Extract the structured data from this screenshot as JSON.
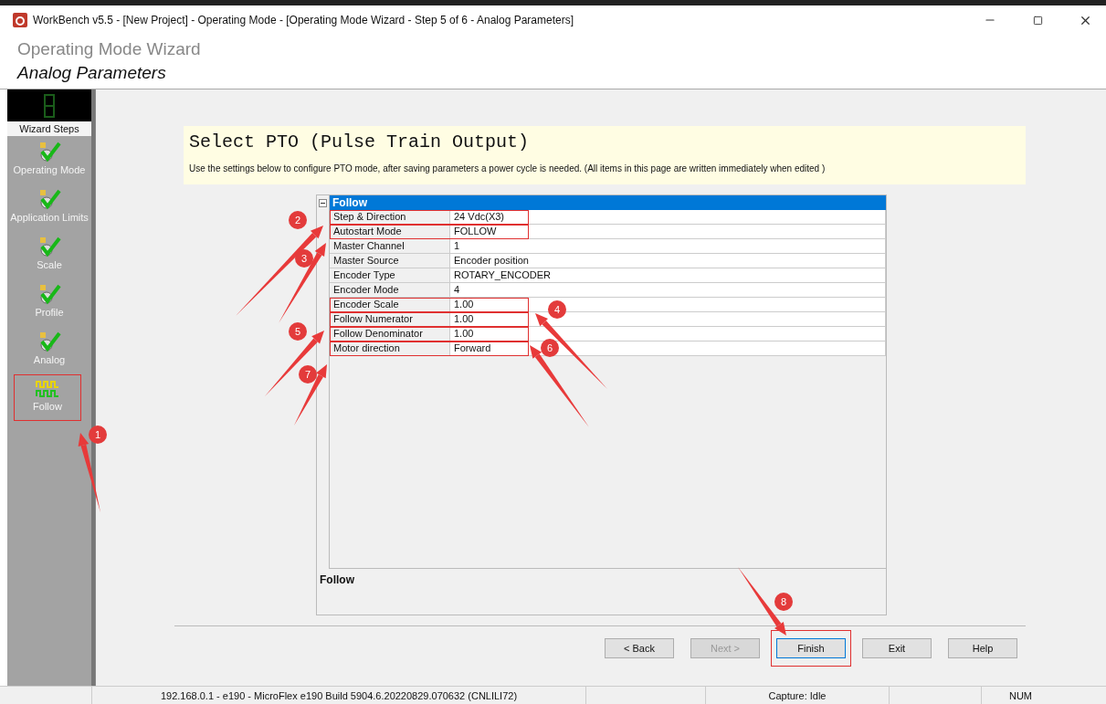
{
  "window": {
    "title": "WorkBench v5.5 - [New Project] - Operating Mode - [Operating Mode Wizard - Step 5 of 6 - Analog Parameters]"
  },
  "header": {
    "title": "Operating Mode Wizard",
    "subtitle": "Analog Parameters"
  },
  "sidebar": {
    "title": "Wizard Steps",
    "items": [
      {
        "label": "Operating Mode",
        "kind": "check",
        "highlighted": false
      },
      {
        "label": "Application Limits",
        "kind": "check",
        "highlighted": false
      },
      {
        "label": "Scale",
        "kind": "check",
        "highlighted": false
      },
      {
        "label": "Profile",
        "kind": "check",
        "highlighted": false
      },
      {
        "label": "Analog",
        "kind": "check",
        "highlighted": false
      },
      {
        "label": "Follow",
        "kind": "wave",
        "highlighted": true
      }
    ]
  },
  "intro": {
    "title": "Select PTO (Pulse Train Output)",
    "text": "Use the settings below to configure PTO mode, after saving parameters a power cycle is needed. (All items in this page are written immediately when edited )"
  },
  "property_grid": {
    "category": "Follow",
    "expanded": true,
    "rows": [
      {
        "name": "Step & Direction",
        "value": "24 Vdc(X3)",
        "highlighted": true
      },
      {
        "name": "Autostart Mode",
        "value": "FOLLOW",
        "highlighted": true
      },
      {
        "name": "Master Channel",
        "value": "1",
        "highlighted": false
      },
      {
        "name": "Master Source",
        "value": "Encoder position",
        "highlighted": false
      },
      {
        "name": "Encoder Type",
        "value": "ROTARY_ENCODER",
        "highlighted": false
      },
      {
        "name": "Encoder Mode",
        "value": "4",
        "highlighted": false
      },
      {
        "name": "Encoder Scale",
        "value": "1.00",
        "highlighted": true
      },
      {
        "name": "Follow Numerator",
        "value": "1.00",
        "highlighted": true
      },
      {
        "name": "Follow Denominator",
        "value": "1.00",
        "highlighted": true
      },
      {
        "name": "Motor direction",
        "value": "Forward",
        "highlighted": true
      }
    ],
    "description_title": "Follow"
  },
  "buttons": [
    {
      "label": "< Back",
      "disabled": false,
      "focused": false,
      "highlighted": false
    },
    {
      "label": "Next >",
      "disabled": true,
      "focused": false,
      "highlighted": false
    },
    {
      "label": "Finish",
      "disabled": false,
      "focused": true,
      "highlighted": true
    },
    {
      "label": "Exit",
      "disabled": false,
      "focused": false,
      "highlighted": false
    },
    {
      "label": "Help",
      "disabled": false,
      "focused": false,
      "highlighted": false
    }
  ],
  "status_bar": [
    "192.168.0.1 - e190 - MicroFlex e190 Build 5904.6.20220829.070632 (CNLILI72)",
    "Capture: Idle",
    "NUM"
  ],
  "annotations": [
    {
      "number": "1"
    },
    {
      "number": "2"
    },
    {
      "number": "3"
    },
    {
      "number": "4"
    },
    {
      "number": "5"
    },
    {
      "number": "6"
    },
    {
      "number": "7"
    },
    {
      "number": "8"
    }
  ]
}
